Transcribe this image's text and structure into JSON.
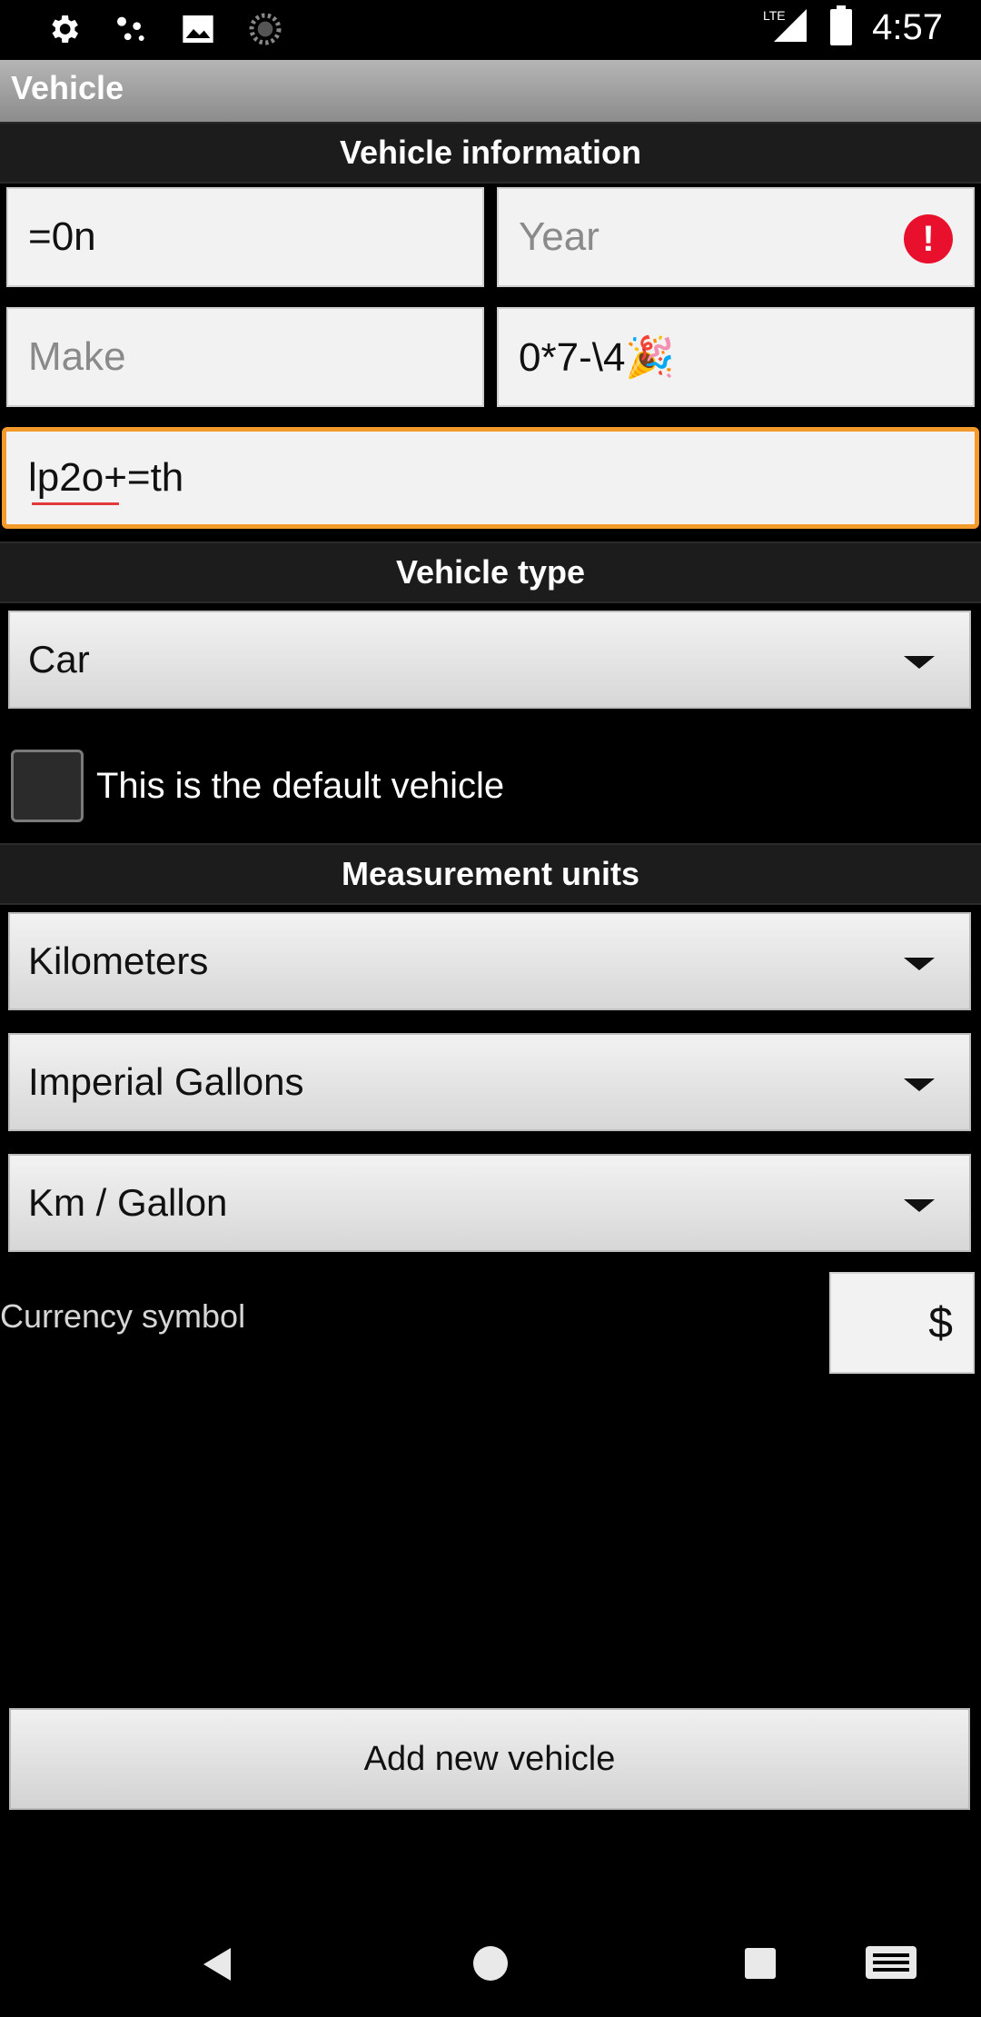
{
  "status_bar": {
    "time": "4:57",
    "network": "LTE",
    "icons": [
      "gear-icon",
      "dots-icon",
      "image-icon",
      "loading-icon",
      "signal-icon",
      "battery-icon"
    ]
  },
  "app_bar": {
    "title": "Vehicle"
  },
  "sections": {
    "info": "Vehicle information",
    "type": "Vehicle type",
    "units": "Measurement units"
  },
  "fields": {
    "name": {
      "value": "=0n"
    },
    "year": {
      "placeholder": "Year",
      "error": true
    },
    "make": {
      "placeholder": "Make"
    },
    "model": {
      "value": "0*7-\\4🎉"
    },
    "extra": {
      "value": "lp2o+=th"
    }
  },
  "vehicle_type": {
    "selected": "Car"
  },
  "default_vehicle": {
    "label": "This is the default vehicle",
    "checked": false
  },
  "units": {
    "distance": "Kilometers",
    "volume": "Imperial Gallons",
    "economy": "Km / Gallon"
  },
  "currency": {
    "label": "Currency symbol",
    "value": "$"
  },
  "actions": {
    "add_new_vehicle": "Add new vehicle"
  },
  "colors": {
    "focus": "#f39a2c",
    "error": "#e8102c",
    "app_bar": "#a0a0a0",
    "section_bg": "#1c1c1c"
  }
}
